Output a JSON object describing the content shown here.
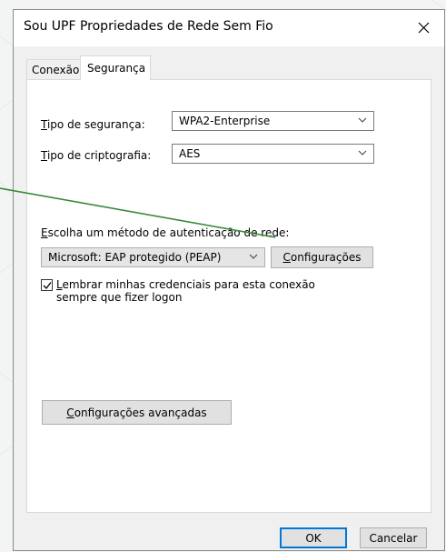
{
  "window": {
    "title": "Sou UPF Propriedades de Rede Sem Fio"
  },
  "tabs": [
    {
      "label": "Conexão",
      "selected": false
    },
    {
      "label": "Segurança",
      "selected": true
    }
  ],
  "security": {
    "type_label_pre": "T",
    "type_label_rest": "ipo de segurança:",
    "type_value": "WPA2-Enterprise",
    "encryption_label_pre": "T",
    "encryption_label_rest": "ipo de criptografia:",
    "encryption_value": "AES"
  },
  "auth": {
    "label_pre": "E",
    "label_rest": "scolha um método de autenticação de rede:",
    "method_value": "Microsoft: EAP protegido (PEAP)",
    "settings_button_pre": "C",
    "settings_button_rest": "onfigurações"
  },
  "remember": {
    "checked": true,
    "line1_pre": "L",
    "line1_rest": "embrar minhas credenciais para esta conexão",
    "line2": "sempre que fizer logon"
  },
  "advanced": {
    "button_pre": "C",
    "button_rest": "onfigurações avançadas"
  },
  "footer": {
    "ok_label": "OK",
    "cancel_label": "Cancelar"
  },
  "colors": {
    "annotation_arrow": "#3a8a3a",
    "accent": "#0078d7"
  }
}
